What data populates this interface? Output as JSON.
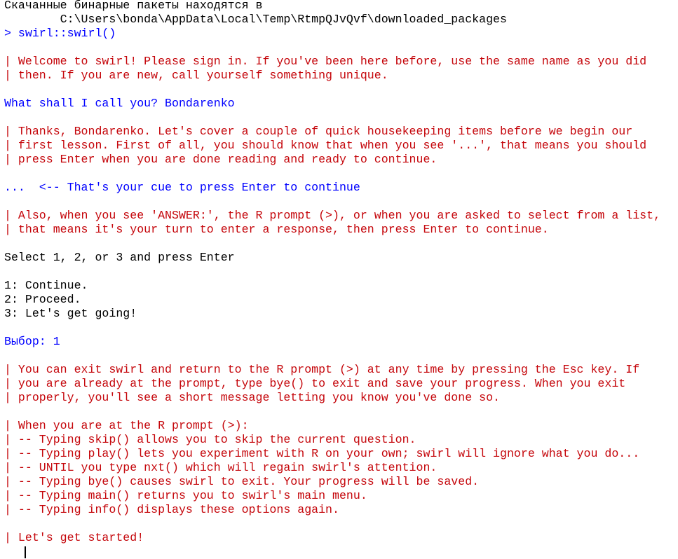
{
  "colors": {
    "background": "#ffffff",
    "output": "#000000",
    "message": "#c5060b",
    "input": "#0000ff"
  },
  "console": {
    "lines": [
      {
        "text": "Скачанные бинарные пакеты находятся в",
        "kind": "out"
      },
      {
        "text": "        C:\\Users\\bonda\\AppData\\Local\\Temp\\RtmpQJvQvf\\downloaded_packages",
        "kind": "out"
      },
      {
        "text": "> swirl::swirl()",
        "kind": "input"
      },
      {
        "text": "",
        "kind": "out"
      },
      {
        "text": "| Welcome to swirl! Please sign in. If you've been here before, use the same name as you did",
        "kind": "msg"
      },
      {
        "text": "| then. If you are new, call yourself something unique.",
        "kind": "msg"
      },
      {
        "text": "",
        "kind": "out"
      },
      {
        "text": "What shall I call you? Bondarenko",
        "kind": "input"
      },
      {
        "text": "",
        "kind": "out"
      },
      {
        "text": "| Thanks, Bondarenko. Let's cover a couple of quick housekeeping items before we begin our",
        "kind": "msg"
      },
      {
        "text": "| first lesson. First of all, you should know that when you see '...', that means you should",
        "kind": "msg"
      },
      {
        "text": "| press Enter when you are done reading and ready to continue.",
        "kind": "msg"
      },
      {
        "text": "",
        "kind": "out"
      },
      {
        "text": "...  <-- That's your cue to press Enter to continue",
        "kind": "input"
      },
      {
        "text": "",
        "kind": "out"
      },
      {
        "text": "| Also, when you see 'ANSWER:', the R prompt (>), or when you are asked to select from a list,",
        "kind": "msg"
      },
      {
        "text": "| that means it's your turn to enter a response, then press Enter to continue.",
        "kind": "msg"
      },
      {
        "text": "",
        "kind": "out"
      },
      {
        "text": "Select 1, 2, or 3 and press Enter",
        "kind": "out"
      },
      {
        "text": "",
        "kind": "out"
      },
      {
        "text": "1: Continue.",
        "kind": "out"
      },
      {
        "text": "2: Proceed.",
        "kind": "out"
      },
      {
        "text": "3: Let's get going!",
        "kind": "out"
      },
      {
        "text": "",
        "kind": "out"
      },
      {
        "text": "Выбор: 1",
        "kind": "input"
      },
      {
        "text": "",
        "kind": "out"
      },
      {
        "text": "| You can exit swirl and return to the R prompt (>) at any time by pressing the Esc key. If",
        "kind": "msg"
      },
      {
        "text": "| you are already at the prompt, type bye() to exit and save your progress. When you exit",
        "kind": "msg"
      },
      {
        "text": "| properly, you'll see a short message letting you know you've done so.",
        "kind": "msg"
      },
      {
        "text": "",
        "kind": "out"
      },
      {
        "text": "| When you are at the R prompt (>):",
        "kind": "msg"
      },
      {
        "text": "| -- Typing skip() allows you to skip the current question.",
        "kind": "msg"
      },
      {
        "text": "| -- Typing play() lets you experiment with R on your own; swirl will ignore what you do...",
        "kind": "msg"
      },
      {
        "text": "| -- UNTIL you type nxt() which will regain swirl's attention.",
        "kind": "msg"
      },
      {
        "text": "| -- Typing bye() causes swirl to exit. Your progress will be saved.",
        "kind": "msg"
      },
      {
        "text": "| -- Typing main() returns you to swirl's main menu.",
        "kind": "msg"
      },
      {
        "text": "| -- Typing info() displays these options again.",
        "kind": "msg"
      },
      {
        "text": "",
        "kind": "out"
      },
      {
        "text": "| Let's get started!",
        "kind": "msg"
      }
    ]
  }
}
